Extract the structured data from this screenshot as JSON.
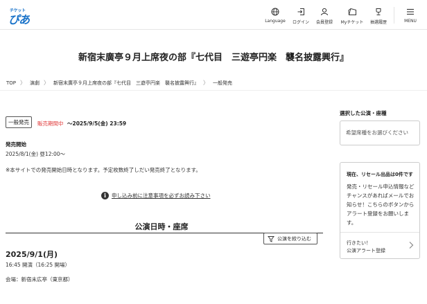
{
  "header": {
    "logo_small": "チケット",
    "logo_main": "ぴあ",
    "nav": [
      {
        "label": "Language",
        "icon": "globe-icon"
      },
      {
        "label": "ログイン",
        "icon": "login-icon"
      },
      {
        "label": "会員登録",
        "icon": "user-icon"
      },
      {
        "label": "Myチケット",
        "icon": "ticket-icon"
      },
      {
        "label": "抽選履歴",
        "icon": "trophy-icon"
      },
      {
        "label": "MENU",
        "icon": "hamburger-icon"
      }
    ]
  },
  "page": {
    "title": "新宿末廣亭９月上席夜の部『七代目　三遊亭円楽　襲名披露興行』"
  },
  "breadcrumb": [
    "TOP",
    "演劇",
    "新宿末廣亭９月上席夜の部『七代目　三遊亭円楽　襲名披露興行』",
    "一般発売"
  ],
  "sale": {
    "type_tag": "一般発売",
    "status": "販売期間中",
    "until": "〜2025/9/5(金) 23:59",
    "start_label": "発売開始",
    "start_date": "2025/8/1(金) 昼12:00〜",
    "note": "※本サイトでの発売開始日時となります。予定枚数終了しだい発売終了となります。",
    "notice_link": "申し込み前に注意事項を必ずお読み下さい"
  },
  "performances": {
    "section_title": "公演日時・座席",
    "filter_label": "公演を絞り込む",
    "items": [
      {
        "date": "2025/9/1(月)",
        "time": "16:45 開演（16:25 開場）",
        "venue": "会場：新宿末広亭（東京都）"
      }
    ]
  },
  "sidebar": {
    "selected_label": "選択した公演・座種",
    "selected_placeholder": "希望席種をお選びください",
    "resale_title": "現在、リセール出品は0件です",
    "resale_body": "発売・リセール申込情報などチャンスがあればメールでお知らせ！こちらのボタンからアラート登録をお願いします。",
    "alert_line1": "行きたい！",
    "alert_line2": "公演アラート登録"
  },
  "colors": {
    "brand": "#1a73c9",
    "status_red": "#e03a3a"
  }
}
